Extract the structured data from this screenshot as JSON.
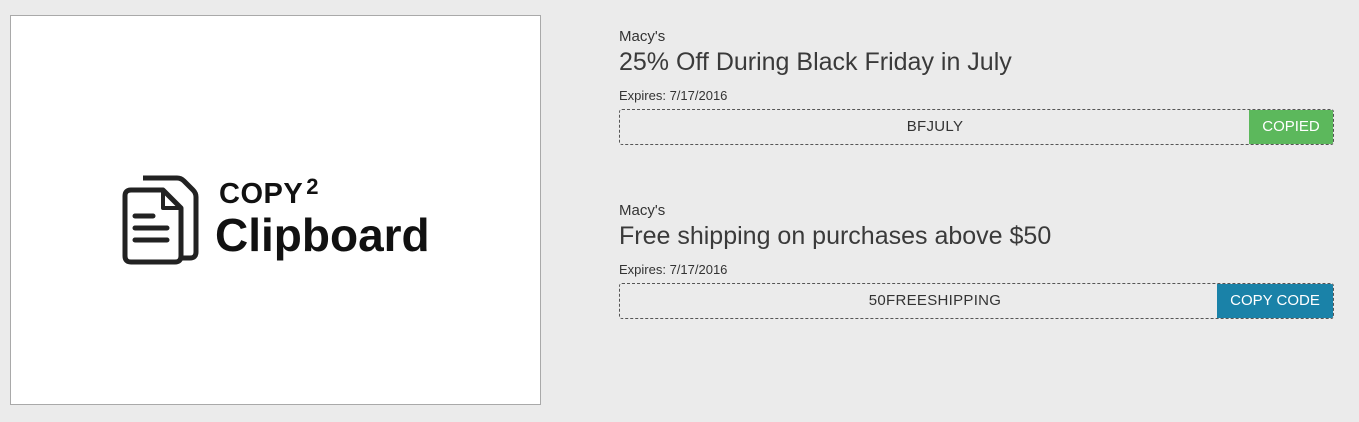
{
  "preview": {
    "logo_copy": "COPY",
    "logo_superscript": "2",
    "logo_clipboard": "Clipboard"
  },
  "deals": [
    {
      "store": "Macy's",
      "title": "25% Off During Black Friday in July",
      "expires": "Expires: 7/17/2016",
      "code": "BFJULY",
      "button_label": "COPIED",
      "button_color": "#5cb85c"
    },
    {
      "store": "Macy's",
      "title": "Free shipping on purchases above $50",
      "expires": "Expires: 7/17/2016",
      "code": "50FREESHIPPING",
      "button_label": "COPY CODE",
      "button_color": "#1a82a8"
    }
  ],
  "icons": {
    "logo": "clipboard-documents-icon"
  }
}
